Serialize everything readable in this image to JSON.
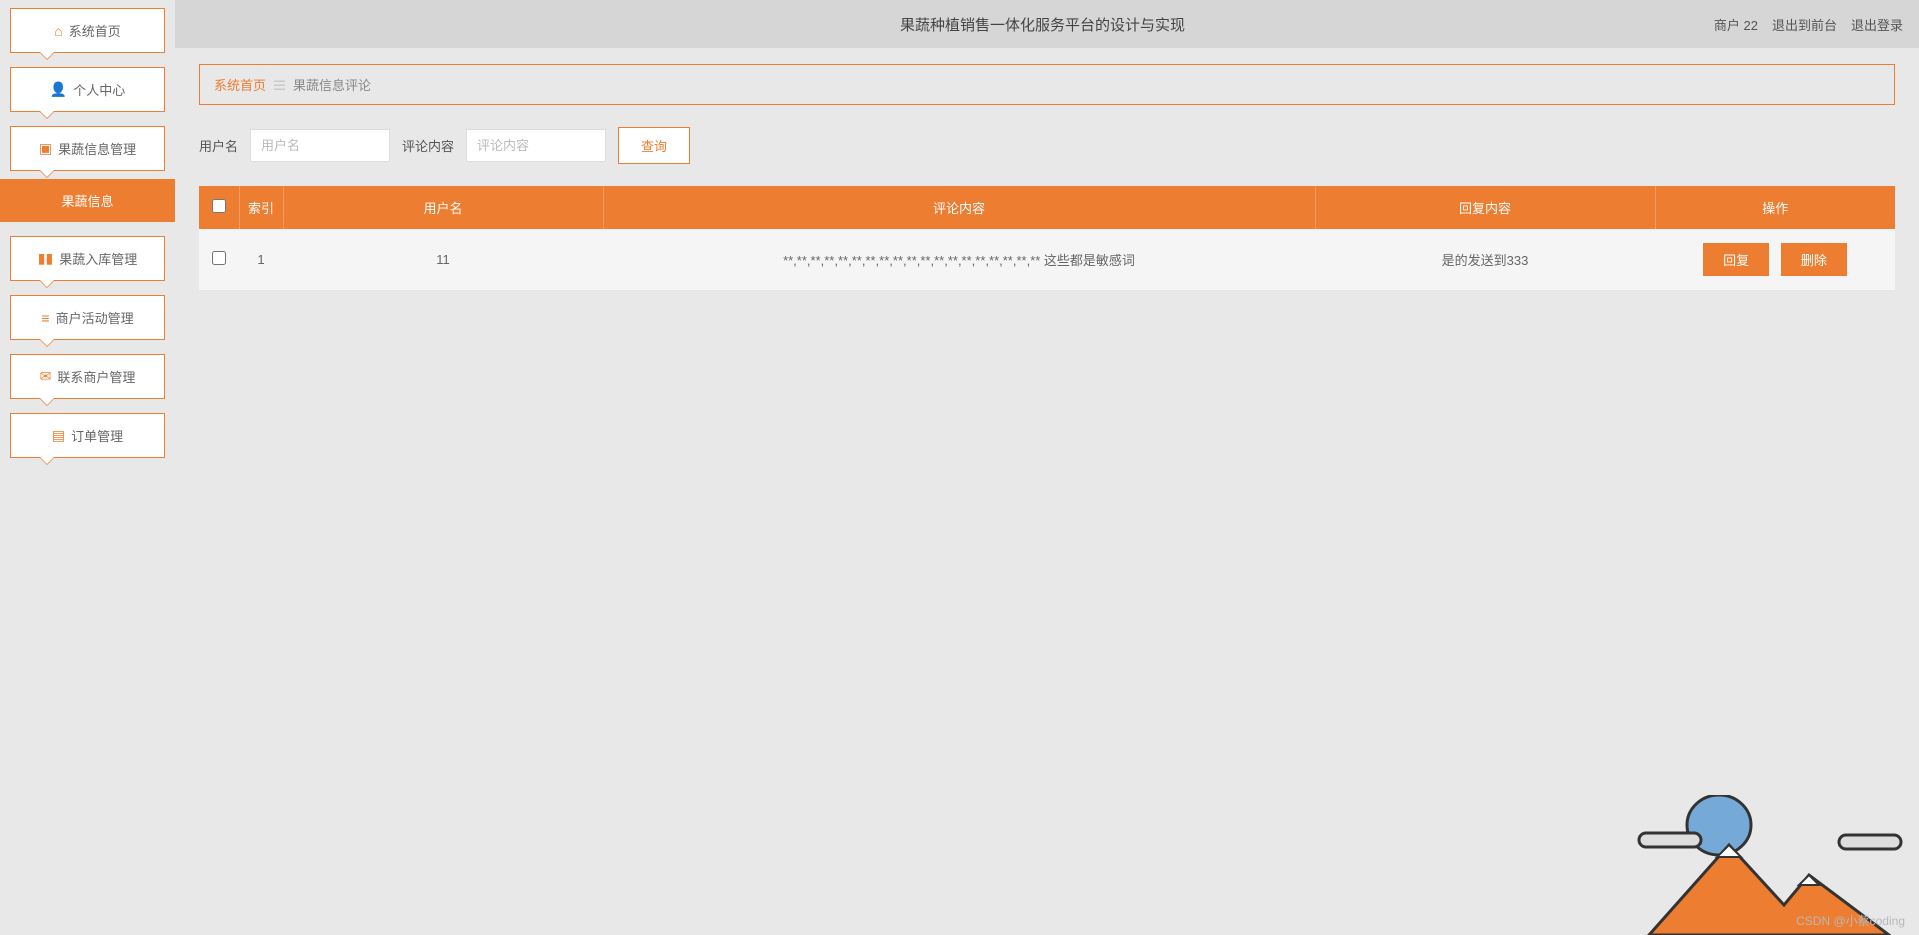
{
  "header": {
    "title": "果蔬种植销售一体化服务平台的设计与实现",
    "user_label": "商户 22",
    "logout_front": "退出到前台",
    "logout": "退出登录"
  },
  "sidebar": {
    "items": [
      {
        "icon": "home-icon",
        "glyph": "⌂",
        "label": "系统首页"
      },
      {
        "icon": "user-icon",
        "glyph": "👤",
        "label": "个人中心"
      },
      {
        "icon": "fruit-info-icon",
        "glyph": "▣",
        "label": "果蔬信息管理"
      },
      {
        "icon": "stock-icon",
        "glyph": "▮▮",
        "label": "果蔬入库管理"
      },
      {
        "icon": "activity-icon",
        "glyph": "≡",
        "label": "商户活动管理"
      },
      {
        "icon": "contact-icon",
        "glyph": "✉",
        "label": "联系商户管理"
      },
      {
        "icon": "order-icon",
        "glyph": "▤",
        "label": "订单管理"
      }
    ],
    "sub_item": "果蔬信息"
  },
  "breadcrumb": {
    "home": "系统首页",
    "current": "果蔬信息评论"
  },
  "search": {
    "username_label": "用户名",
    "username_placeholder": "用户名",
    "content_label": "评论内容",
    "content_placeholder": "评论内容",
    "button": "查询"
  },
  "table": {
    "columns": [
      "索引",
      "用户名",
      "评论内容",
      "回复内容",
      "操作"
    ],
    "rows": [
      {
        "index": "1",
        "username": "11",
        "comment": "**,**,**,**,**,**,**,**,**,**,**,**,**,**,**,**,**,**,** 这些都是敏感词",
        "reply": "是的发送到333"
      }
    ],
    "op_reply": "回复",
    "op_delete": "删除"
  },
  "watermark": "CSDN @小蔡coding"
}
